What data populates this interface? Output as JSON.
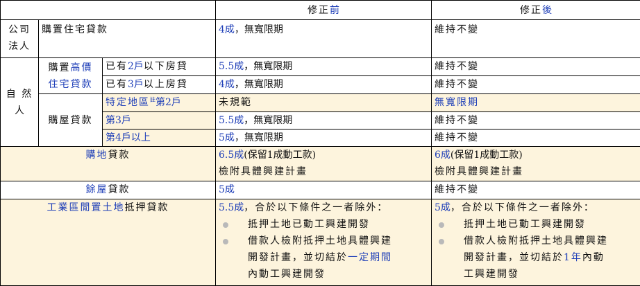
{
  "header": {
    "col_before_prefix": "修正",
    "col_before_highlight": "前",
    "col_after_prefix": "修正",
    "col_after_highlight": "後"
  },
  "rows": {
    "corp": {
      "label_l1": "公司",
      "label_l2": "法人",
      "item": "購置住宅貸款",
      "before_highlight": "4成",
      "before_rest": "，無寬限期",
      "after": "維持不變"
    },
    "natural_label_l1": "自 然",
    "natural_label_l2": "人",
    "luxury": {
      "label_prefix": "購置",
      "label_hl1": "高價",
      "label_hl2": "住宅貸款",
      "r1_cond_pre": "已有",
      "r1_cond_hl": "2戶",
      "r1_cond_post": "以下房貸",
      "r1_before_hl": "5.5成",
      "r1_before_rest": "，無寬限期",
      "r1_after": "維持不變",
      "r2_cond_pre": "已有",
      "r2_cond_hl": "3戶",
      "r2_cond_post": "以上房貸",
      "r2_before_hl": "4成",
      "r2_before_rest": "，無寬限期",
      "r2_after": "維持不變"
    },
    "house": {
      "label": "購屋貸款",
      "r1_cond_pre": "特定地區",
      "r1_cond_note": "註",
      "r1_cond_post": "第2戶",
      "r1_before": "未規範",
      "r1_after": "無寬限期",
      "r2_cond": "第3戶",
      "r2_before_hl": "5.5成",
      "r2_before_rest": "，無寬限期",
      "r2_after": "維持不變",
      "r3_cond": "第4戶以上",
      "r3_before_hl": "5成",
      "r3_before_rest": "，無寬限期",
      "r3_after": "維持不變"
    },
    "land": {
      "label_hl": "購地",
      "label_rest": "貸款",
      "before_hl": "6.5成",
      "before_rest": "(保留1成動工款)",
      "before_l2": "檢附具體興建計畫",
      "after_hl": "6成",
      "after_rest": "(保留1成動工款)",
      "after_l2": "檢附具體興建計畫"
    },
    "surplus": {
      "label_hl": "餘屋",
      "label_rest": "貸款",
      "before_hl": "5成",
      "after": "維持不變"
    },
    "idle": {
      "label_hl": "工業區閒置土地",
      "label_rest": "抵押貸款",
      "before_hl": "5.5成",
      "before_rest": "，合於以下條件之一者除外：",
      "before_b1": "抵押土地已動工興建開發",
      "before_b2_l1": "借款人檢附抵押土地具體興建",
      "before_b2_l2_pre": "開發計畫，並切結於",
      "before_b2_l2_hl": "一定期間",
      "before_b2_l3": "內動工興建開發",
      "after_hl": "5成",
      "after_rest": "，合於以下條件之一者除外：",
      "after_b1": "抵押土地已動工興建開發",
      "after_b2_l1": "借款人檢附抵押土地具體興建",
      "after_b2_l2_pre": "開發計畫，並切結於",
      "after_b2_l2_hl": "1年",
      "after_b2_l2_post": "內動",
      "after_b2_l3": "工興建開發"
    }
  },
  "colors": {
    "highlight": "#1f3fb8",
    "tan_background": "#fdf4dd",
    "bullet": "#b9b9b9"
  }
}
